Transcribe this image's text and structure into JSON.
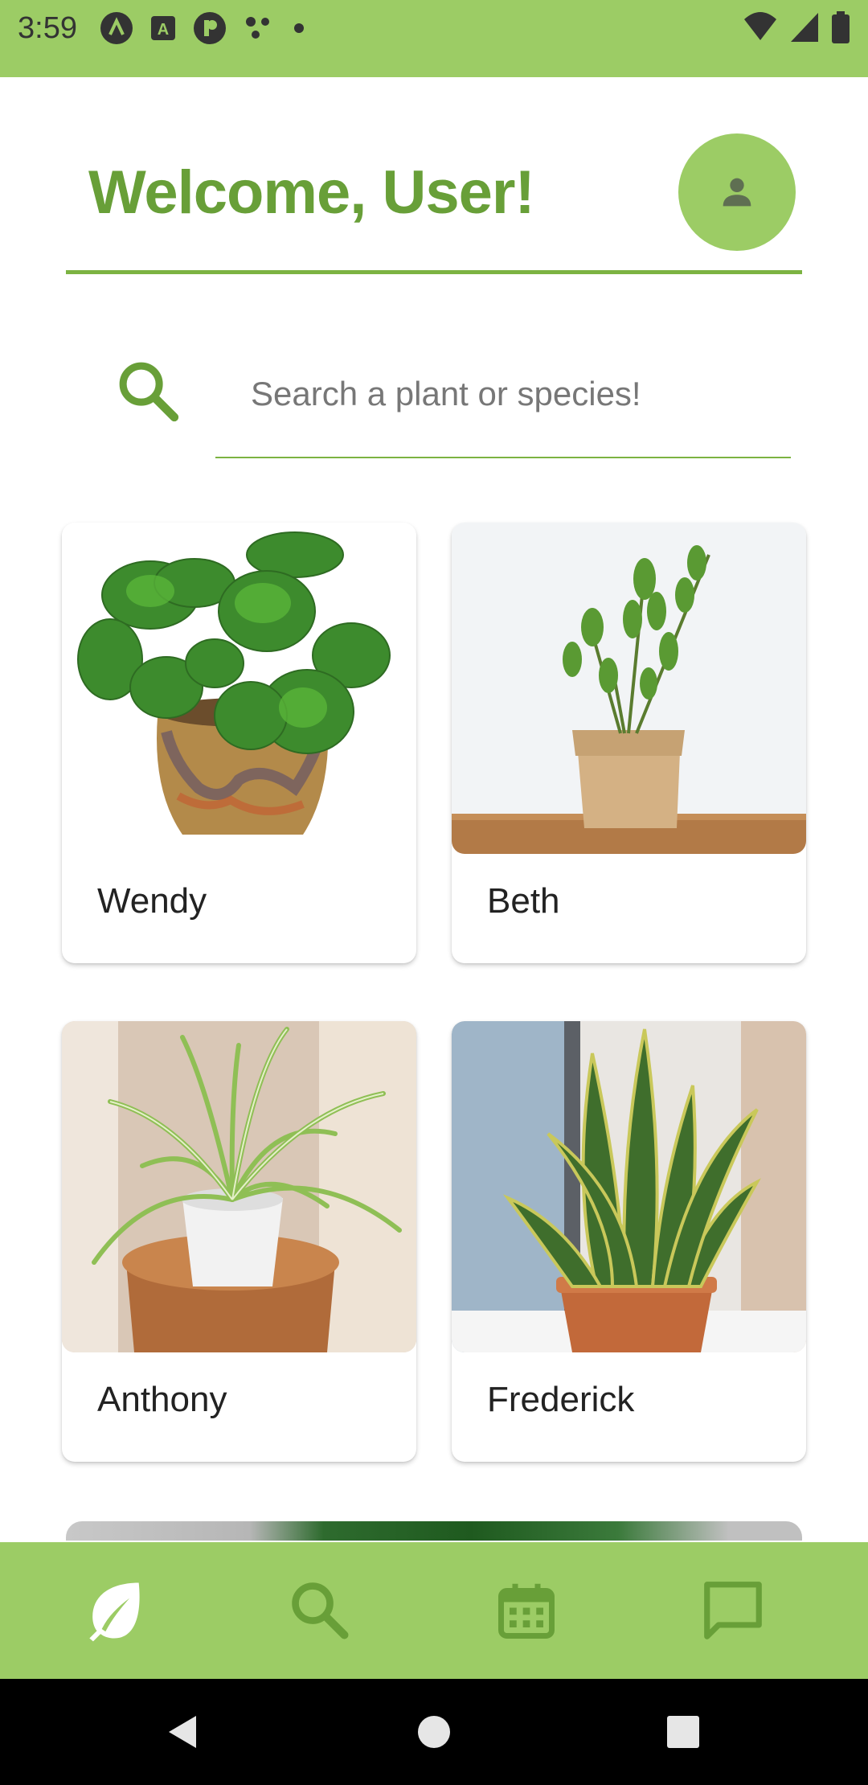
{
  "status_bar": {
    "time": "3:59"
  },
  "header": {
    "title": "Welcome, User!"
  },
  "search": {
    "placeholder": "Search a plant or species!"
  },
  "plants": [
    {
      "name": "Wendy"
    },
    {
      "name": "Beth"
    },
    {
      "name": "Anthony"
    },
    {
      "name": "Frederick"
    }
  ],
  "bottom_nav": {
    "items": [
      {
        "icon": "leaf-icon",
        "active": true
      },
      {
        "icon": "search-icon",
        "active": false
      },
      {
        "icon": "calendar-icon",
        "active": false
      },
      {
        "icon": "chat-icon",
        "active": false
      }
    ]
  },
  "colors": {
    "accent": "#9ccc65",
    "accent_dark": "#689f38",
    "divider": "#7cb342"
  }
}
